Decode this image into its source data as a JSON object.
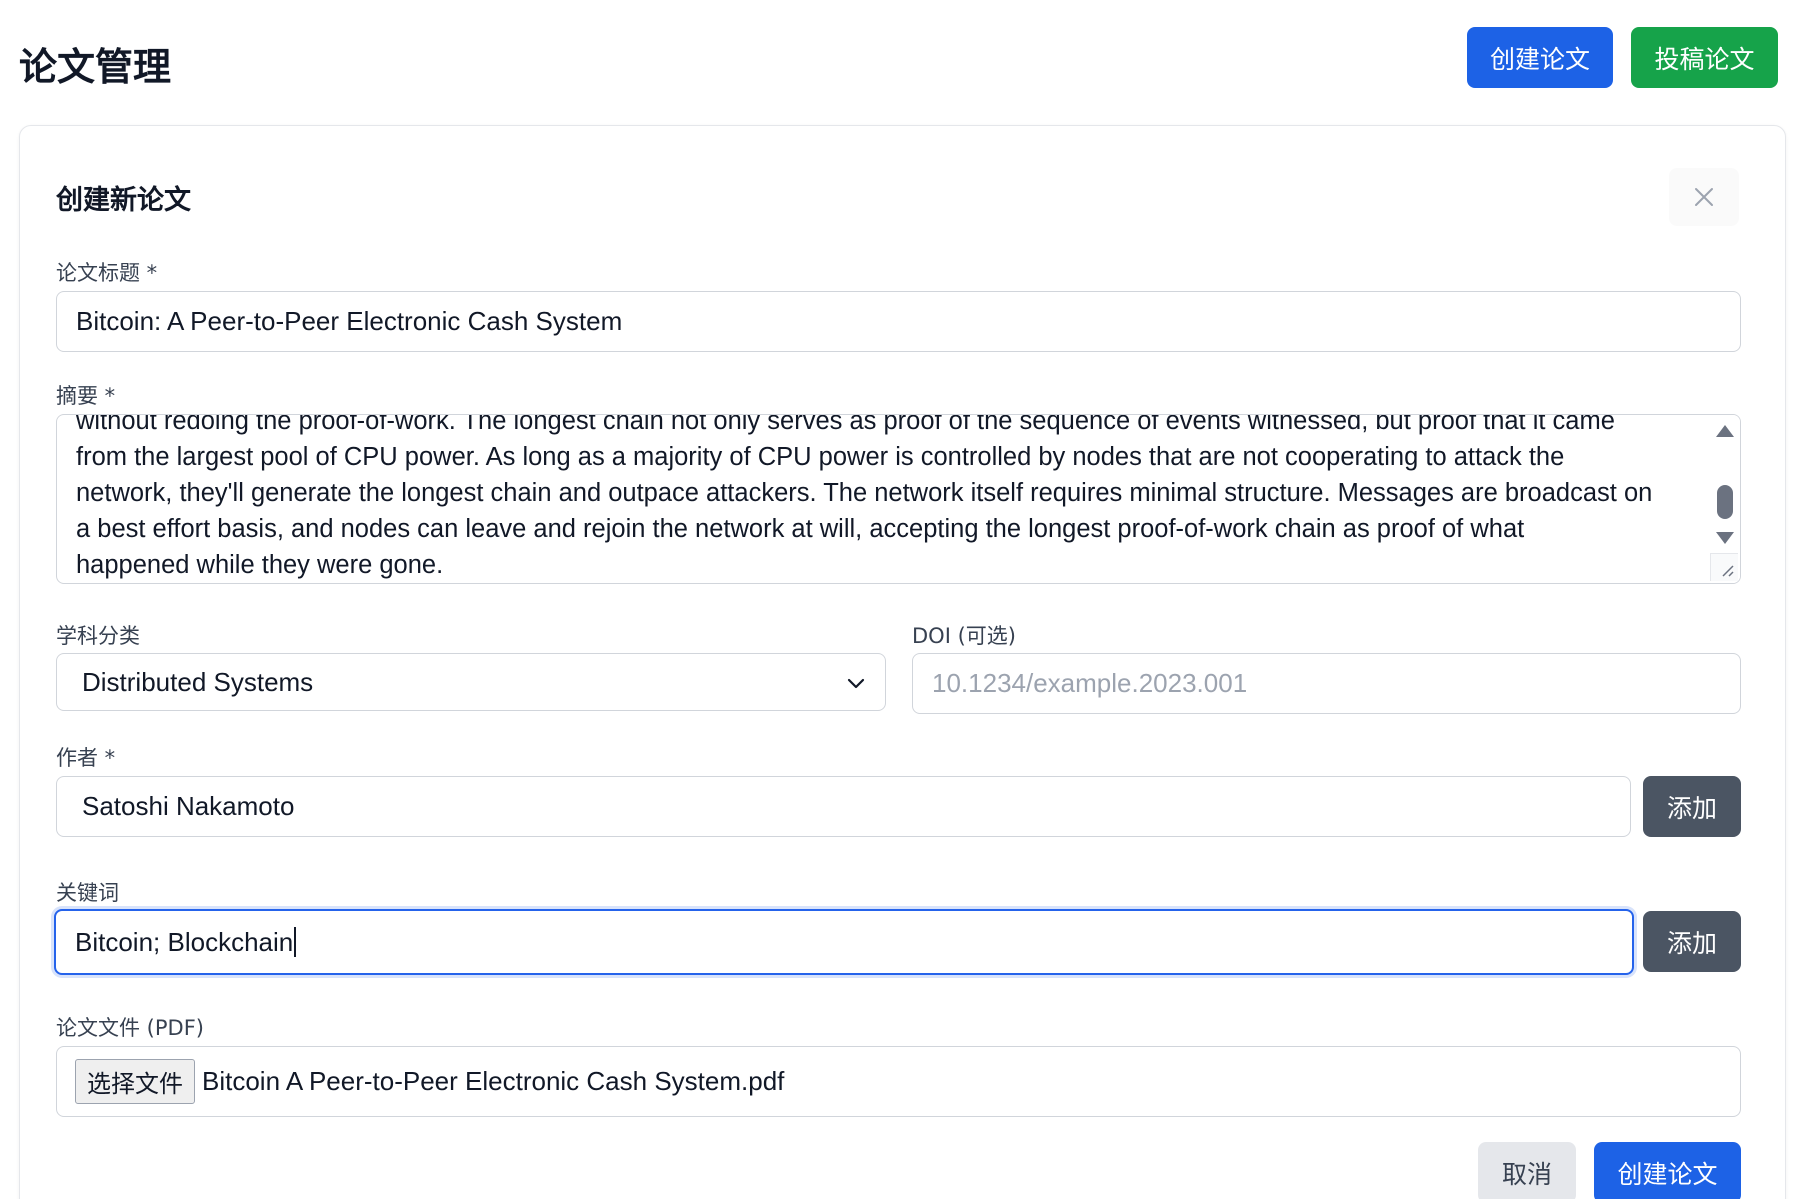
{
  "header": {
    "title": "论文管理",
    "create_button": "创建论文",
    "submit_button": "投稿论文"
  },
  "form": {
    "title": "创建新论文",
    "close_icon": "×",
    "paper_title": {
      "label": "论文标题 *",
      "value": "Bitcoin: A Peer-to-Peer Electronic Cash System"
    },
    "abstract": {
      "label": "摘要 *",
      "lines": [
        "without redoing the proof-of-work. The longest chain not only serves as proof of the sequence of events witnessed, but proof that it came",
        "from the largest pool of CPU power. As long as a majority of CPU power is controlled by nodes that are not cooperating to attack the",
        "network, they'll generate the longest chain and outpace attackers. The network itself requires minimal structure. Messages are broadcast on",
        "a best effort basis, and nodes can leave and rejoin the network at will, accepting the longest proof-of-work chain as proof of what",
        "happened while they were gone."
      ]
    },
    "subject": {
      "label": "学科分类",
      "selected": "Distributed Systems"
    },
    "doi": {
      "label": "DOI (可选)",
      "placeholder": "10.1234/example.2023.001"
    },
    "authors": {
      "label": "作者 *",
      "value": "Satoshi Nakamoto",
      "add_button": "添加"
    },
    "keywords": {
      "label": "关键词",
      "value": "Bitcoin; Blockchain",
      "add_button": "添加"
    },
    "file": {
      "label": "论文文件 (PDF)",
      "choose_button": "选择文件",
      "file_name": "Bitcoin A Peer-to-Peer Electronic Cash System.pdf"
    },
    "cancel_button": "取消",
    "submit_button": "创建论文"
  }
}
